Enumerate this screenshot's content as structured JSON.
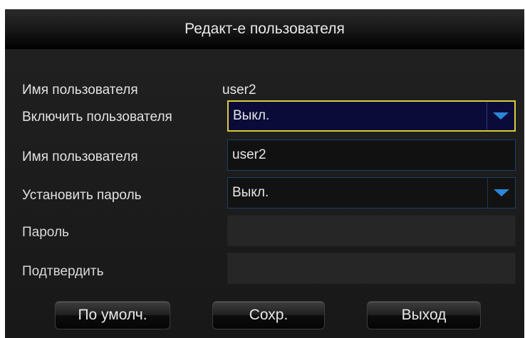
{
  "dialog": {
    "title": "Редакт-е пользователя"
  },
  "form": {
    "username_label": "Имя пользователя",
    "username_value": "user2",
    "enable_user_label": "Включить пользователя",
    "enable_user_value": "Выкл.",
    "user_name_label": "Имя пользователя",
    "user_name_value": "user2",
    "set_password_label": "Установить пароль",
    "set_password_value": "Выкл.",
    "password_label": "Пароль",
    "password_value": "",
    "confirm_label": "Подтвердить",
    "confirm_value": ""
  },
  "buttons": {
    "default_label": "По умолч.",
    "save_label": "Сохр.",
    "exit_label": "Выход"
  },
  "colors": {
    "focus_border": "#d9cc3a",
    "field_border": "#1c3f66",
    "dropdown_arrow": "#2a86d8",
    "focused_bg": "#0b0b3a"
  },
  "icons": {
    "dropdown": "chevron-down-icon"
  }
}
